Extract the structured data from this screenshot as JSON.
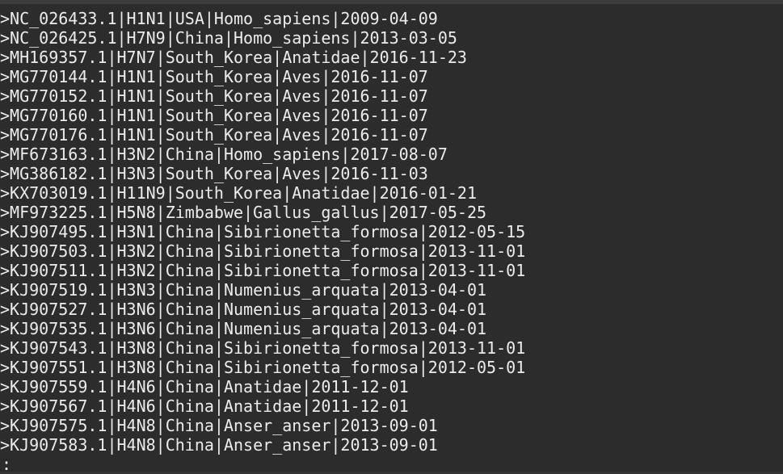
{
  "terminal": {
    "lines": [
      ">NC_026433.1|H1N1|USA|Homo_sapiens|2009-04-09",
      ">NC_026425.1|H7N9|China|Homo_sapiens|2013-03-05",
      ">MH169357.1|H7N7|South_Korea|Anatidae|2016-11-23",
      ">MG770144.1|H1N1|South_Korea|Aves|2016-11-07",
      ">MG770152.1|H1N1|South_Korea|Aves|2016-11-07",
      ">MG770160.1|H1N1|South_Korea|Aves|2016-11-07",
      ">MG770176.1|H1N1|South_Korea|Aves|2016-11-07",
      ">MF673163.1|H3N2|China|Homo_sapiens|2017-08-07",
      ">MG386182.1|H3N3|South_Korea|Aves|2016-11-03",
      ">KX703019.1|H11N9|South_Korea|Anatidae|2016-01-21",
      ">MF973225.1|H5N8|Zimbabwe|Gallus_gallus|2017-05-25",
      ">KJ907495.1|H3N1|China|Sibirionetta_formosa|2012-05-15",
      ">KJ907503.1|H3N2|China|Sibirionetta_formosa|2013-11-01",
      ">KJ907511.1|H3N2|China|Sibirionetta_formosa|2013-11-01",
      ">KJ907519.1|H3N3|China|Numenius_arquata|2013-04-01",
      ">KJ907527.1|H3N6|China|Numenius_arquata|2013-04-01",
      ">KJ907535.1|H3N6|China|Numenius_arquata|2013-04-01",
      ">KJ907543.1|H3N8|China|Sibirionetta_formosa|2013-11-01",
      ">KJ907551.1|H3N8|China|Sibirionetta_formosa|2012-05-01",
      ">KJ907559.1|H4N6|China|Anatidae|2011-12-01",
      ">KJ907567.1|H4N6|China|Anatidae|2011-12-01",
      ">KJ907575.1|H4N8|China|Anser_anser|2013-09-01",
      ">KJ907583.1|H4N8|China|Anser_anser|2013-09-01"
    ],
    "prompt": ":"
  }
}
